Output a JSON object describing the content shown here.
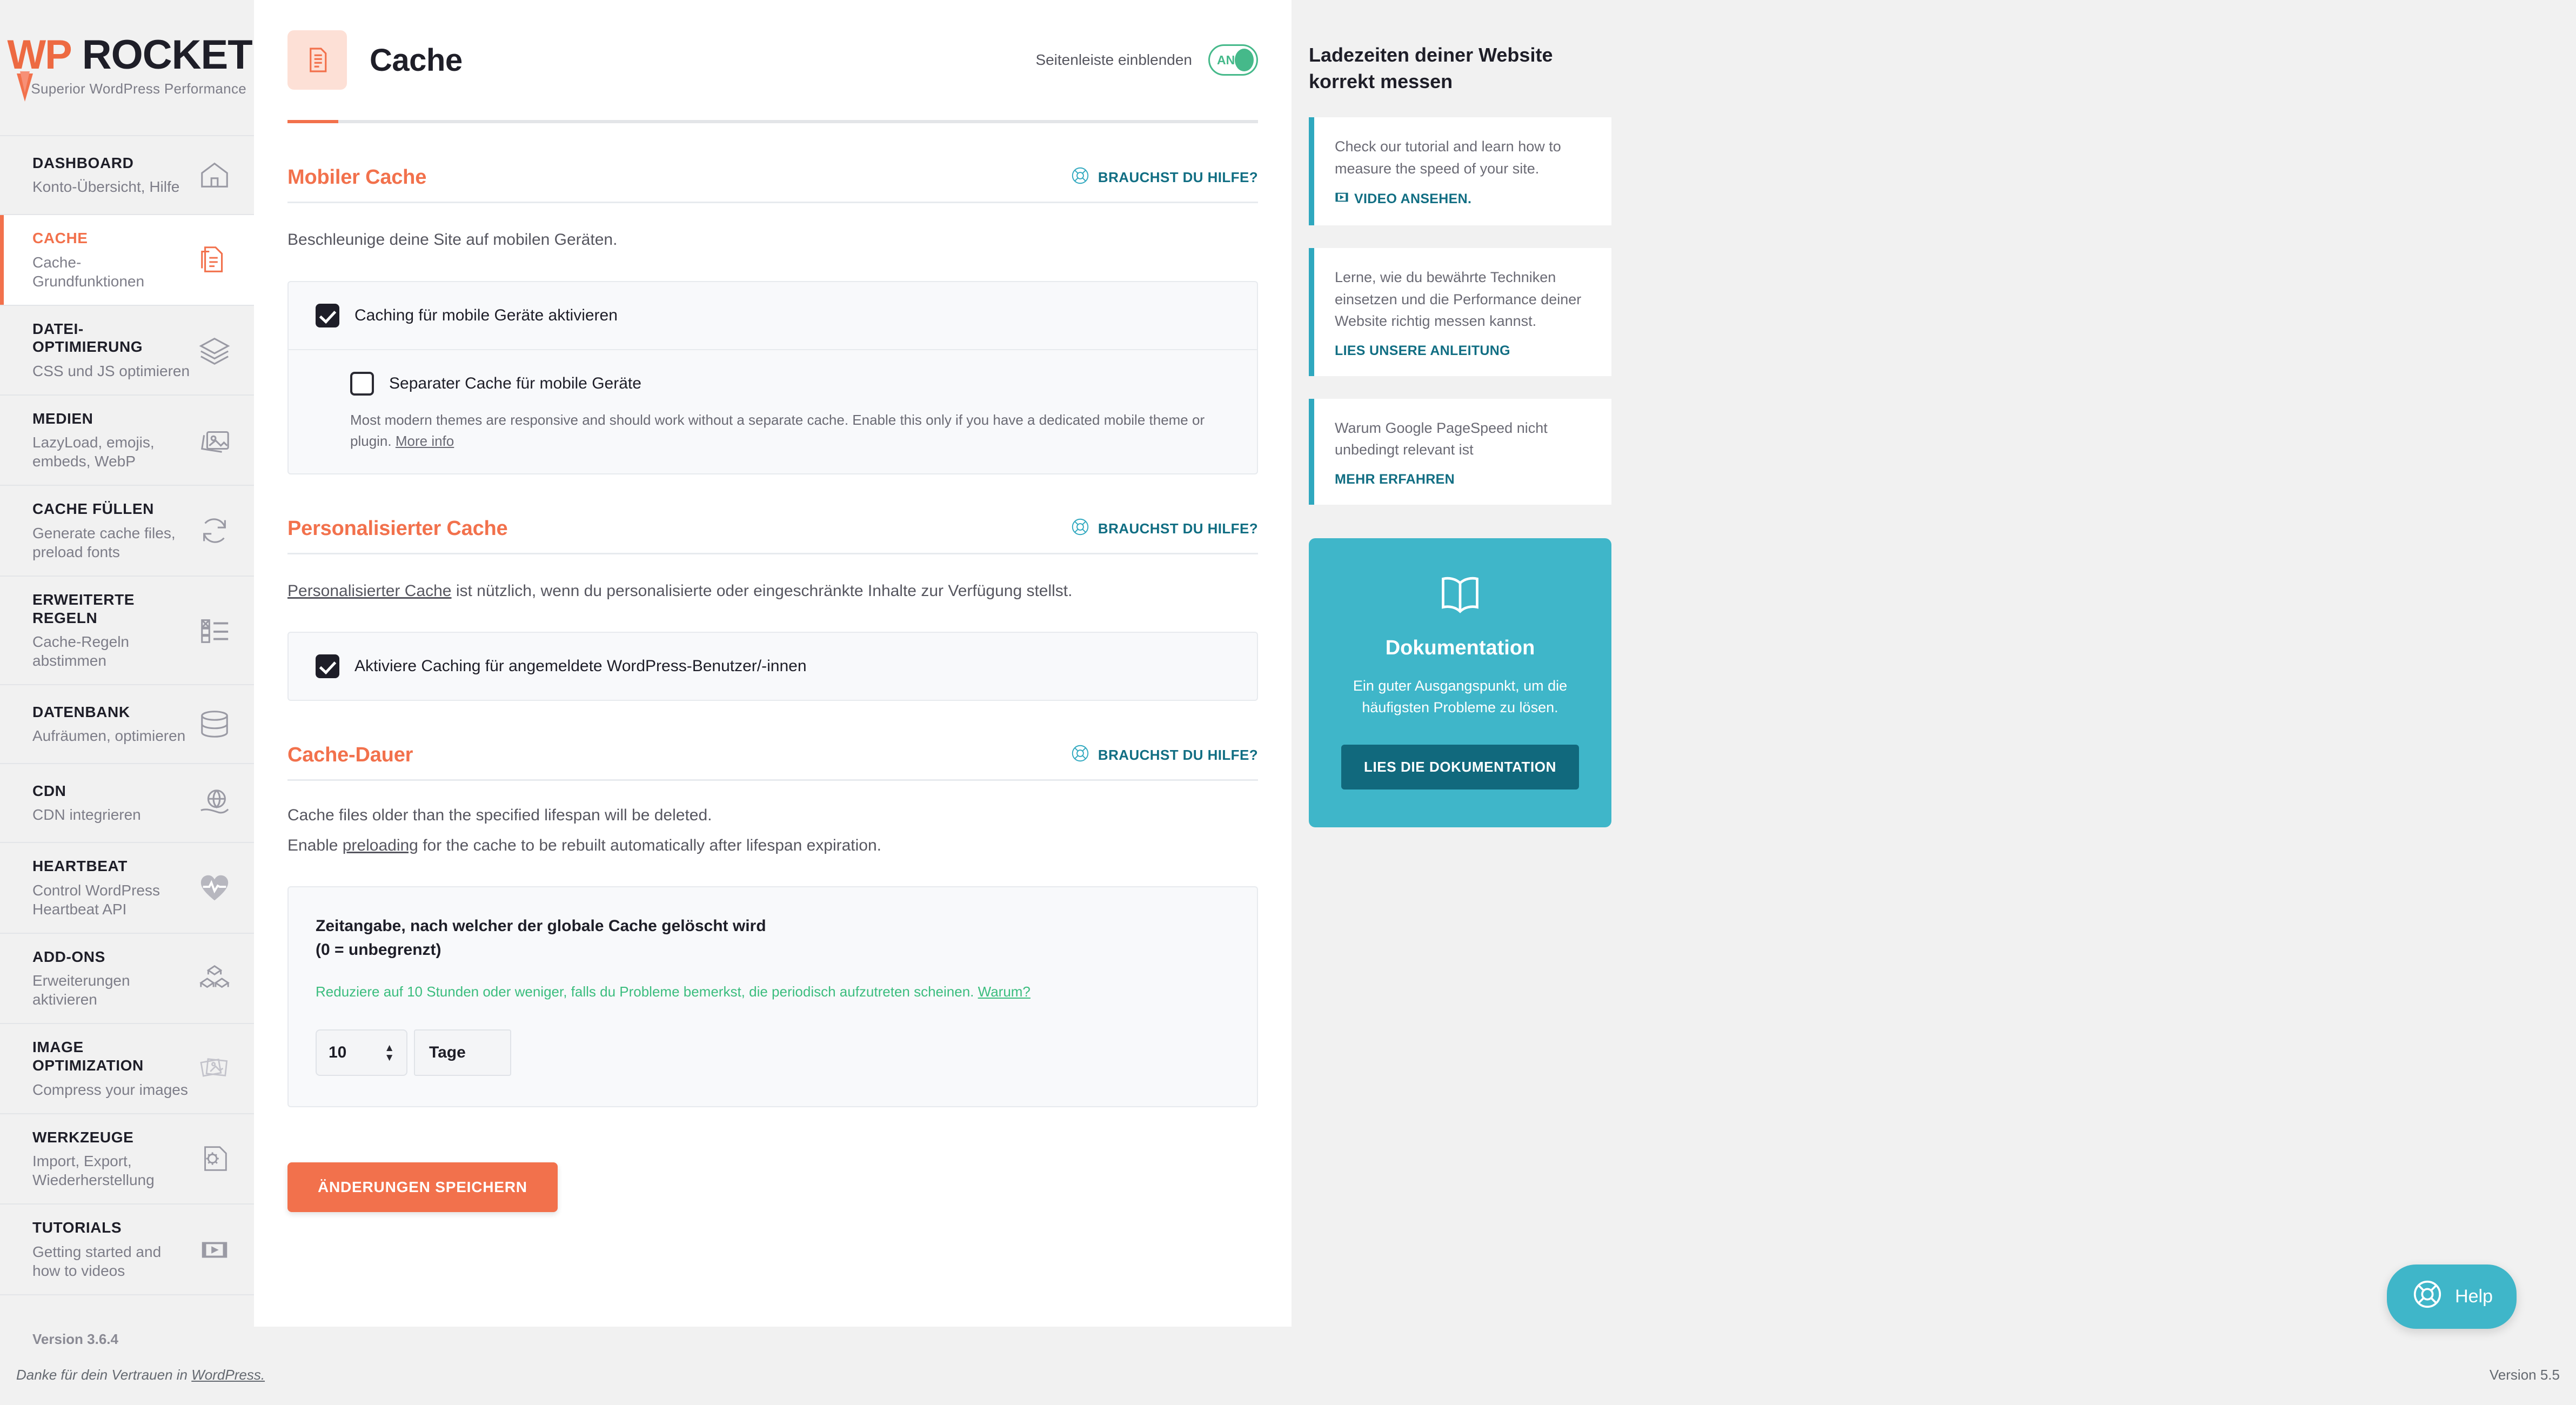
{
  "brand": {
    "logo_wp": "WP",
    "logo_rocket": "ROCKET",
    "tagline": "Superior WordPress Performance",
    "accent_orange": "#f2714c",
    "accent_teal": "#116e83",
    "accent_green": "#45b98a"
  },
  "sidebar": {
    "version": "Version 3.6.4",
    "items": [
      {
        "title": "DASHBOARD",
        "sub": "Konto-Übersicht, Hilfe",
        "icon": "home-icon",
        "active": false
      },
      {
        "title": "CACHE",
        "sub": "Cache-Grundfunktionen",
        "icon": "document-icon",
        "active": true
      },
      {
        "title": "DATEI-OPTIMIERUNG",
        "sub": "CSS und JS optimieren",
        "icon": "layers-icon",
        "active": false
      },
      {
        "title": "MEDIEN",
        "sub": "LazyLoad, emojis, embeds, WebP",
        "icon": "images-icon",
        "active": false
      },
      {
        "title": "CACHE FÜLLEN",
        "sub": "Generate cache files, preload fonts",
        "icon": "refresh-icon",
        "active": false
      },
      {
        "title": "ERWEITERTE REGELN",
        "sub": "Cache-Regeln abstimmen",
        "icon": "checklist-icon",
        "active": false
      },
      {
        "title": "DATENBANK",
        "sub": "Aufräumen, optimieren",
        "icon": "database-icon",
        "active": false
      },
      {
        "title": "CDN",
        "sub": "CDN integrieren",
        "icon": "globe-hand-icon",
        "active": false
      },
      {
        "title": "HEARTBEAT",
        "sub": "Control WordPress Heartbeat API",
        "icon": "heartbeat-icon",
        "active": false
      },
      {
        "title": "ADD-ONS",
        "sub": "Erweiterungen aktivieren",
        "icon": "blocks-icon",
        "active": false
      },
      {
        "title": "IMAGE OPTIMIZATION",
        "sub": "Compress your images",
        "icon": "photos-icon",
        "active": false
      },
      {
        "title": "WERKZEUGE",
        "sub": "Import, Export, Wiederherstellung",
        "icon": "gear-file-icon",
        "active": false
      },
      {
        "title": "TUTORIALS",
        "sub": "Getting started and how to videos",
        "icon": "video-icon",
        "active": false
      }
    ]
  },
  "header": {
    "title": "Cache",
    "icon": "document-icon",
    "sidebar_toggle_label": "Seitenleiste einblenden",
    "toggle_state": "AN"
  },
  "help_label": "BRAUCHST DU HILFE?",
  "sections": {
    "mobile": {
      "title": "Mobiler Cache",
      "desc": "Beschleunige deine Site auf mobilen Geräten.",
      "checkbox_main": {
        "label": "Caching für mobile Geräte aktivieren",
        "checked": true
      },
      "checkbox_sub": {
        "label": "Separater Cache für mobile Geräte",
        "checked": false
      },
      "sub_note": "Most modern themes are responsive and should work without a separate cache. Enable this only if you have a dedicated mobile theme or plugin.",
      "sub_note_link": "More info"
    },
    "personalized": {
      "title": "Personalisierter Cache",
      "desc_link": "Personalisierter Cache",
      "desc_rest": " ist nützlich, wenn du personalisierte oder eingeschränkte Inhalte zur Verfügung stellst.",
      "checkbox_main": {
        "label": "Aktiviere Caching für angemeldete WordPress-Benutzer/-innen",
        "checked": true
      }
    },
    "lifespan": {
      "title": "Cache-Dauer",
      "desc_line1": "Cache files older than the specified lifespan will be deleted.",
      "desc_line2_pre": "Enable ",
      "desc_line2_link": "preloading",
      "desc_line2_post": " for the cache to be rebuilt automatically after lifespan expiration.",
      "field_title_line1": "Zeitangabe, nach welcher der globale Cache gelöscht wird",
      "field_title_line2": "(0 = unbegrenzt)",
      "warning_text": "Reduziere auf 10 Stunden oder weniger, falls du Probleme bemerkst, die periodisch aufzutreten scheinen. ",
      "warning_link": "Warum?",
      "value": "10",
      "unit": "Tage"
    }
  },
  "save_button": "ÄNDERUNGEN SPEICHERN",
  "right_panel": {
    "title": "Ladezeiten deiner Website korrekt messen",
    "tips": [
      {
        "text": "Check our tutorial and learn how to measure the speed of your site.",
        "cta": "VIDEO ANSEHEN.",
        "icon": "video-icon"
      },
      {
        "text": "Lerne, wie du bewährte Techniken einsetzen und die Performance deiner Website richtig messen kannst.",
        "cta": "LIES UNSERE ANLEITUNG",
        "icon": null
      },
      {
        "text": "Warum Google PageSpeed nicht unbedingt relevant ist",
        "cta": "MEHR ERFAHREN",
        "icon": null
      }
    ],
    "doc_card": {
      "icon": "book-icon",
      "title": "Dokumentation",
      "desc": "Ein guter Ausgangspunkt, um die häufigsten Probleme zu lösen.",
      "button": "LIES DIE DOKUMENTATION"
    }
  },
  "help_fab": {
    "label": "Help",
    "icon": "lifebuoy-icon"
  },
  "footer": {
    "left_pre": "Danke für dein Vertrauen in ",
    "left_link": "WordPress.",
    "right": "Version 5.5"
  }
}
